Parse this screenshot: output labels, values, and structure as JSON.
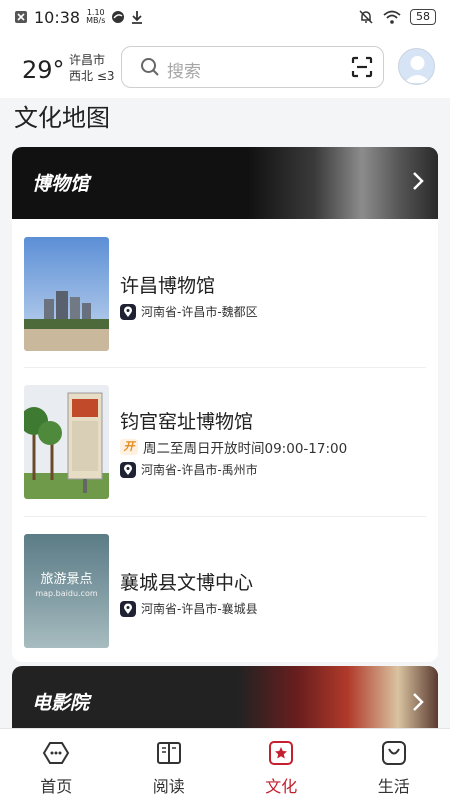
{
  "status_bar": {
    "time": "10:38",
    "net_speed_value": "1.10",
    "net_speed_unit": "MB/s",
    "battery": "58"
  },
  "header": {
    "temperature": "29°",
    "city": "许昌市",
    "wind": "西北 ≤3",
    "search_placeholder": "搜索"
  },
  "page_title": "文化地图",
  "museums": {
    "banner_label": "博物馆",
    "items": [
      {
        "name": "许昌博物馆",
        "location": "河南省-许昌市-魏都区"
      },
      {
        "name": "钧官窑址博物馆",
        "open_badge": "开",
        "hours": "周二至周日开放时间09:00-17:00",
        "location": "河南省-许昌市-禹州市"
      },
      {
        "name": "襄城县文博中心",
        "location": "河南省-许昌市-襄城县",
        "thumb_text": "旅游景点",
        "thumb_subtext": "map.baidu.com"
      }
    ]
  },
  "cinema": {
    "banner_label": "电影院"
  },
  "tabs": [
    {
      "label": "首页",
      "icon": "home-icon"
    },
    {
      "label": "阅读",
      "icon": "book-icon"
    },
    {
      "label": "文化",
      "icon": "culture-icon",
      "active": true
    },
    {
      "label": "生活",
      "icon": "bag-icon"
    }
  ],
  "colors": {
    "accent": "#c4202f",
    "banner_bg": "#111111"
  }
}
